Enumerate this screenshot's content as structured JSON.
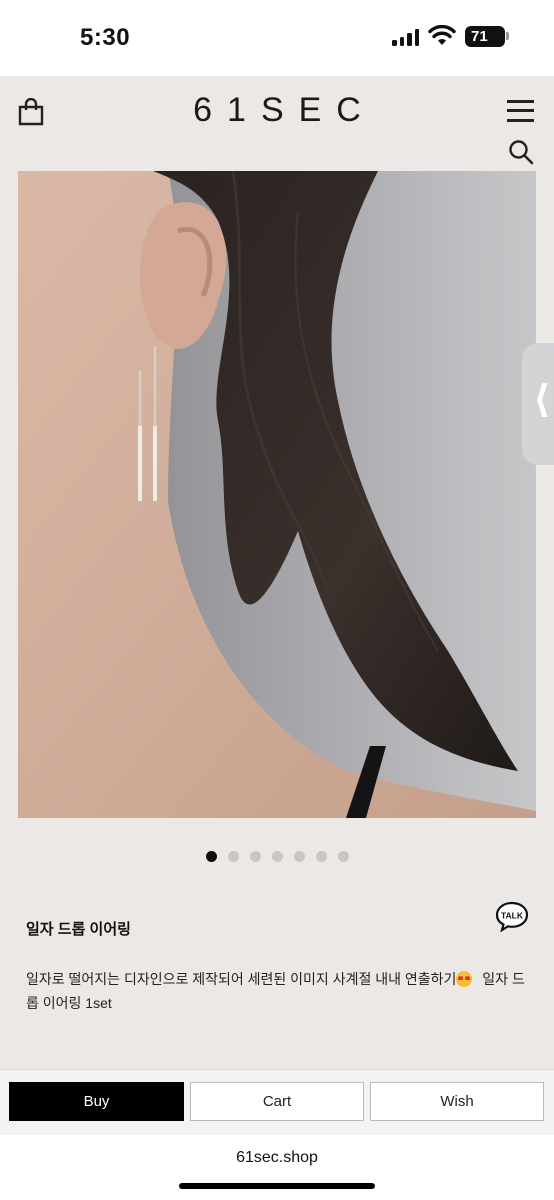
{
  "status_bar": {
    "time": "5:30",
    "battery": "71",
    "icons": [
      "signal-icon",
      "wifi-icon",
      "battery-icon"
    ]
  },
  "header": {
    "brand": "61SEC",
    "icons": [
      "shopping-bag-icon",
      "menu-icon",
      "search-icon"
    ]
  },
  "gallery": {
    "total_slides": 7,
    "active_index": 0,
    "side_tab_icon": "chevron-left-icon"
  },
  "product": {
    "title": "일자 드롭 이어링",
    "description_part1": "일자로 떨어지는 디자인으로 제작되어 세련된 이미지 사계절 내내 연출하기",
    "description_emoji": "heart-eyes-emoji",
    "description_part2": " 일자 드롭 이어링 1set",
    "talk_icon": "kakao-talk-icon",
    "talk_label": "TALK"
  },
  "actions": {
    "buy_label": "Buy",
    "cart_label": "Cart",
    "wish_label": "Wish"
  },
  "browser": {
    "url": "61sec.shop"
  },
  "colors": {
    "background": "#ece8e5",
    "buy_button": "#000000",
    "accent_text": "#111111"
  }
}
